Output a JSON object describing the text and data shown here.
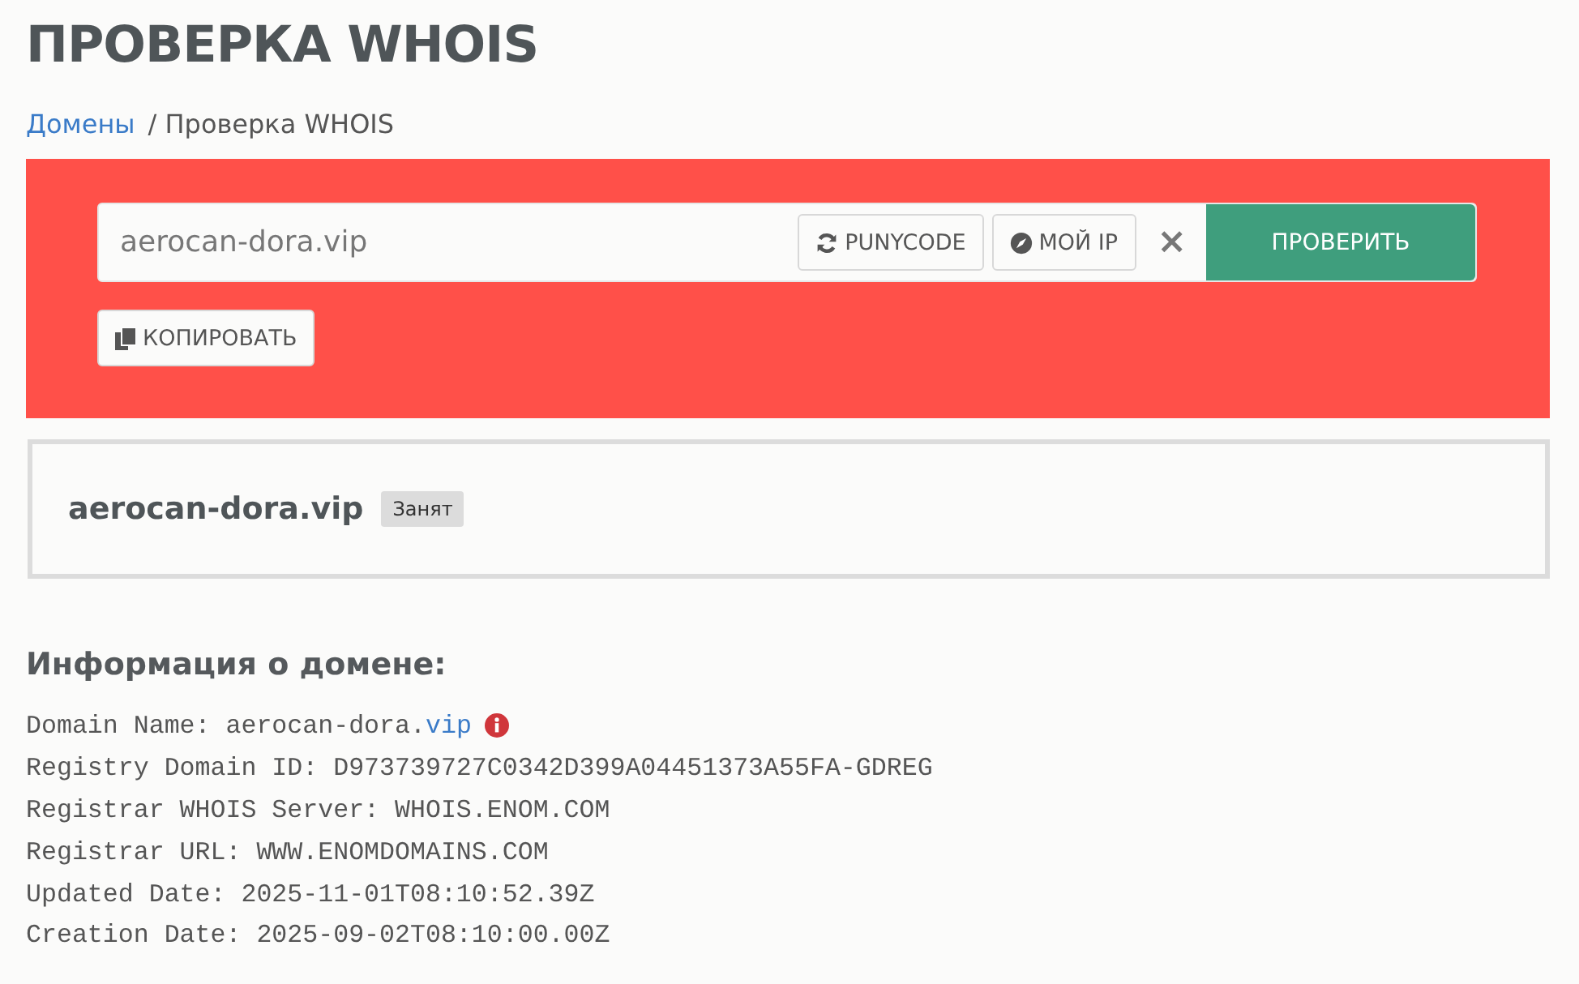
{
  "page_title": "ПРОВЕРКА WHOIS",
  "breadcrumbs": [
    {
      "label": "Домены",
      "link": true
    },
    {
      "label": "/ Проверка WHOIS",
      "link": false
    }
  ],
  "search": {
    "value": "aerocan-dora.vip",
    "buttons": [
      {
        "kind": "punycode",
        "label": "PUNYCODE"
      },
      {
        "kind": "myip",
        "label": "МОЙ IP"
      }
    ],
    "clear": "×",
    "submit": "ПРОВЕРИТЬ",
    "copy": "КОПИРОВАТЬ"
  },
  "result": {
    "domain": "aerocan-dora.vip",
    "status": "Занят"
  },
  "info_heading": "Информация о домене:",
  "whois_lines": [
    {
      "text": "Domain Name: aerocan-dora.",
      "link": "vip",
      "info": true
    },
    {
      "text": "Registry Domain ID: D973739727C0342D399A04451373A55FA-GDREG"
    },
    {
      "text": "Registrar WHOIS Server: WHOIS.ENOM.COM"
    },
    {
      "text": "Registrar URL: WWW.ENOMDOMAINS.COM"
    },
    {
      "text": "Updated Date: 2025-11-01T08:10:52.39Z"
    },
    {
      "text": "Creation Date: 2025-09-02T08:10:00.00Z"
    }
  ]
}
